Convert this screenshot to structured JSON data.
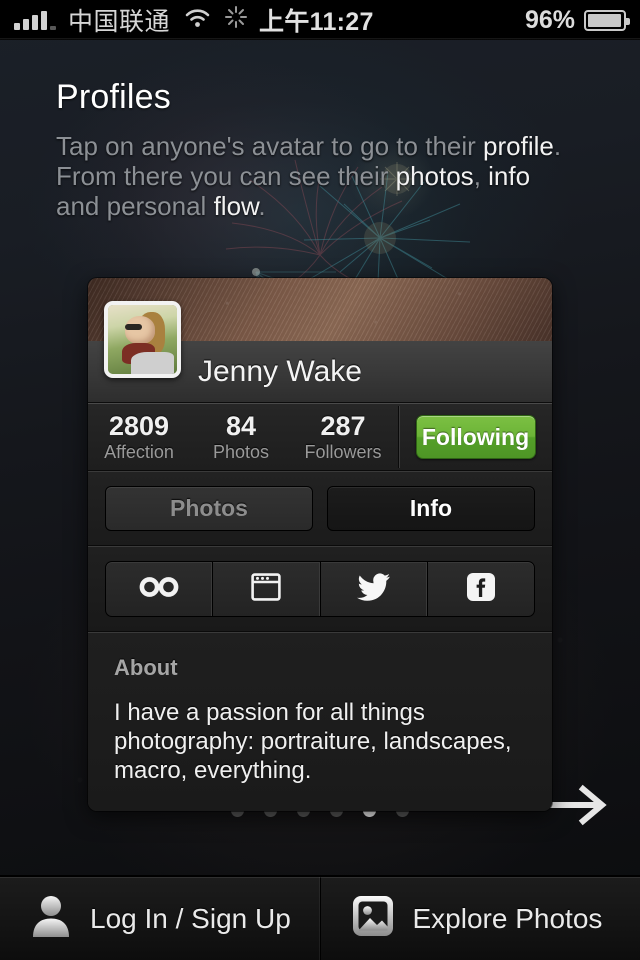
{
  "status_bar": {
    "carrier": "中国联通",
    "time": "上午11:27",
    "battery_percent": "96%",
    "signal_icon": "signal-bars-icon",
    "wifi_icon": "wifi-icon",
    "activity_icon": "activity-spinner-icon",
    "battery_icon": "battery-icon",
    "battery_level": 96
  },
  "intro": {
    "title": "Profiles",
    "desc_parts": [
      {
        "text": "Tap on anyone's avatar to go to their ",
        "em": false
      },
      {
        "text": "profile",
        "em": true
      },
      {
        "text": ". From there you can see their ",
        "em": false
      },
      {
        "text": "photos",
        "em": true
      },
      {
        "text": ", ",
        "em": false
      },
      {
        "text": "info",
        "em": true
      },
      {
        "text": " and personal ",
        "em": false
      },
      {
        "text": "flow",
        "em": true
      },
      {
        "text": ".",
        "em": false
      }
    ]
  },
  "profile_card": {
    "name": "Jenny Wake",
    "avatar_icon": "avatar-photo",
    "cover_icon": "cover-photo",
    "stats": [
      {
        "value": "2809",
        "label": "Affection"
      },
      {
        "value": "84",
        "label": "Photos"
      },
      {
        "value": "287",
        "label": "Followers"
      }
    ],
    "follow_button": {
      "label": "Following",
      "state": "following",
      "color": "#6cb437"
    },
    "tabs": [
      {
        "label": "Photos",
        "active": false
      },
      {
        "label": "Info",
        "active": true
      }
    ],
    "social_links": [
      {
        "icon": "infinity-icon",
        "name": "500px"
      },
      {
        "icon": "browser-window-icon",
        "name": "website"
      },
      {
        "icon": "twitter-bird-icon",
        "name": "twitter"
      },
      {
        "icon": "facebook-icon",
        "name": "facebook"
      }
    ],
    "about": {
      "heading": "About",
      "text": "I have a passion for all things photography: portraiture, landscapes, macro, everything."
    }
  },
  "pager": {
    "total": 6,
    "active_index": 4,
    "next_icon": "arrow-right-icon"
  },
  "bottom_bar": {
    "login": {
      "label": "Log In / Sign Up",
      "icon": "person-icon"
    },
    "explore": {
      "label": "Explore Photos",
      "icon": "photo-icon"
    }
  },
  "theme": {
    "accent_green": "#6cb437",
    "background": "#15171c",
    "card_background": "#1c1c1c"
  }
}
